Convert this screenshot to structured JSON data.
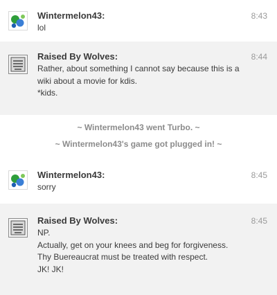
{
  "messages": [
    {
      "user": "Wintermelon43:",
      "time": "8:43",
      "lines": [
        "lol"
      ]
    },
    {
      "user": "Raised By Wolves:",
      "time": "8:44",
      "lines": [
        "Rather, about something I cannot say because this is a",
        "wiki about a movie for kdis.",
        "*kids."
      ]
    },
    {
      "user": "Wintermelon43:",
      "time": "8:45",
      "lines": [
        "sorry"
      ]
    },
    {
      "user": "Raised By Wolves:",
      "time": "8:45",
      "lines": [
        "NP.",
        "Actually, get on your knees and beg for forgiveness.",
        "Thy Buereaucrat must be treated with respect.",
        "JK! JK!"
      ]
    }
  ],
  "alerts": [
    "~ Wintermelon43 went Turbo. ~",
    "~ Wintermelon43's game got plugged in! ~"
  ],
  "colors": {
    "alt_row_bg": "#f2f2f2",
    "text": "#3a3a3a",
    "timestamp": "#9a9a9a",
    "alert_text": "#8c8c8c"
  }
}
